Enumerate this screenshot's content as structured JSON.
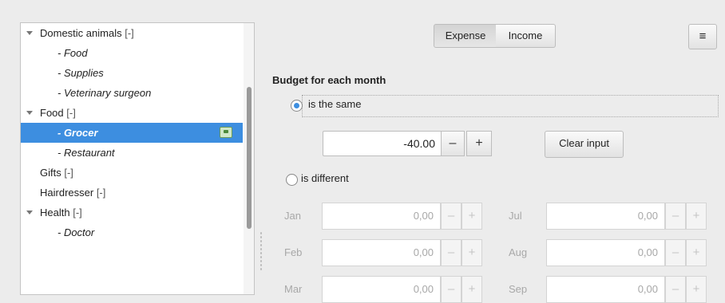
{
  "tree": {
    "items": [
      {
        "label": "Domestic animals",
        "tag": "[-]",
        "expanded": true
      },
      {
        "label": "- Food",
        "sub": true
      },
      {
        "label": "- Supplies",
        "sub": true
      },
      {
        "label": "- Veterinary surgeon",
        "sub": true
      },
      {
        "label": "Food",
        "tag": "[-]",
        "expanded": true
      },
      {
        "label": "- Grocer",
        "sub": true,
        "selected": true
      },
      {
        "label": "- Restaurant",
        "sub": true
      },
      {
        "label": "Gifts",
        "tag": "[-]"
      },
      {
        "label": "Hairdresser",
        "tag": "[-]"
      },
      {
        "label": "Health",
        "tag": "[-]",
        "expanded": true
      },
      {
        "label": "- Doctor",
        "sub": true
      }
    ]
  },
  "toggle": {
    "expense": "Expense",
    "income": "Income",
    "active": "Expense"
  },
  "menu_icon": "≡",
  "budget": {
    "heading": "Budget for each month",
    "same_label": "is the same",
    "same_selected": true,
    "amount": "-40.00",
    "minus": "–",
    "plus": "+",
    "clear": "Clear input",
    "different_label": "is different"
  },
  "months": [
    {
      "name": "Jan",
      "value": "0,00"
    },
    {
      "name": "Jul",
      "value": "0,00"
    },
    {
      "name": "Feb",
      "value": "0,00"
    },
    {
      "name": "Aug",
      "value": "0,00"
    },
    {
      "name": "Mar",
      "value": "0,00"
    },
    {
      "name": "Sep",
      "value": "0,00"
    }
  ],
  "colors": {
    "selection": "#3d8ee0",
    "background": "#ececec"
  }
}
